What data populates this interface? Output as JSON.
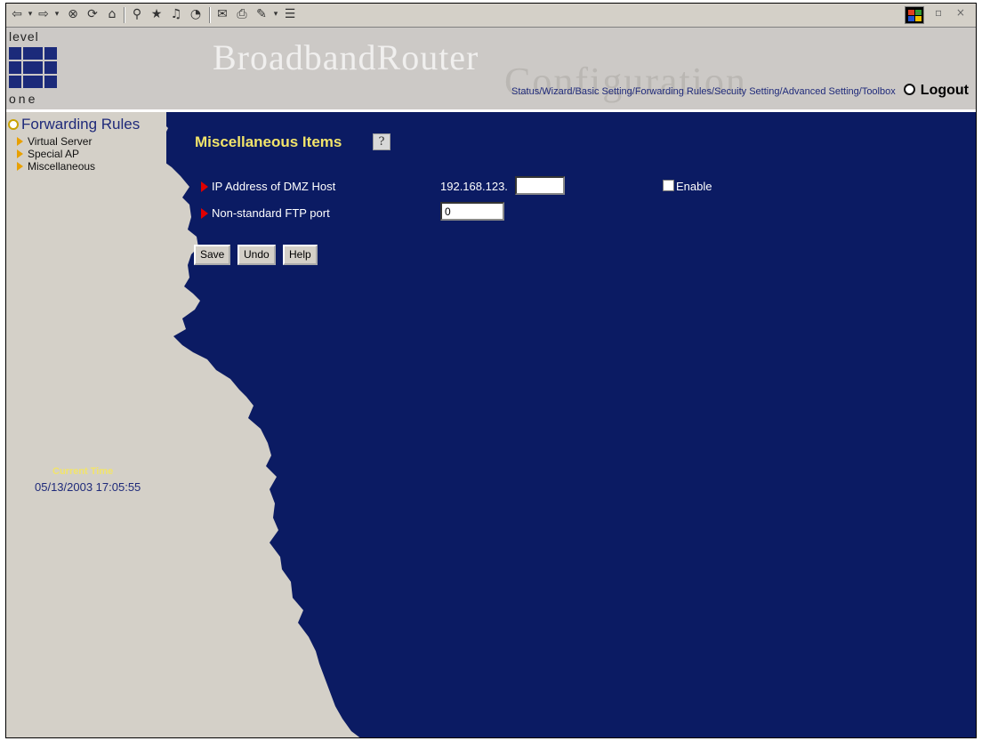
{
  "browser": {
    "toolbar_icons": [
      "back-icon",
      "forward-icon",
      "stop-icon",
      "refresh-icon",
      "home-icon",
      "search-icon",
      "favorites-icon",
      "media-icon",
      "history-icon",
      "mail-icon",
      "print-icon",
      "edit-icon",
      "discuss-icon"
    ]
  },
  "header": {
    "logo_top": "level",
    "logo_bottom": "one",
    "brand_title": "BroadbandRouter",
    "brand_subtitle": "Configuration",
    "nav": [
      "Status/",
      "Wizard/",
      "Basic Setting/",
      "Forwarding Rules/",
      "Secuity Setting/",
      "Advanced Setting/",
      "Toolbox"
    ],
    "logout": "Logout"
  },
  "sidebar": {
    "title": "Forwarding Rules",
    "items": [
      "Virtual Server",
      "Special AP",
      "Miscellaneous"
    ],
    "clock_label": "Current Time",
    "clock_value": "05/13/2003 17:05:55"
  },
  "main": {
    "title": "Miscellaneous Items",
    "dmz_label": "IP Address of DMZ Host",
    "dmz_prefix": "192.168.123.",
    "dmz_value": "",
    "dmz_enable_label": "Enable",
    "ftp_label": "Non-standard FTP port",
    "ftp_value": "0",
    "buttons": {
      "save": "Save",
      "undo": "Undo",
      "help": "Help"
    }
  },
  "colors": {
    "main_background": "#0b1b63",
    "sidebar_background": "#d4d0c8",
    "title_color": "#f2e46a",
    "accent_red": "#e00000"
  }
}
